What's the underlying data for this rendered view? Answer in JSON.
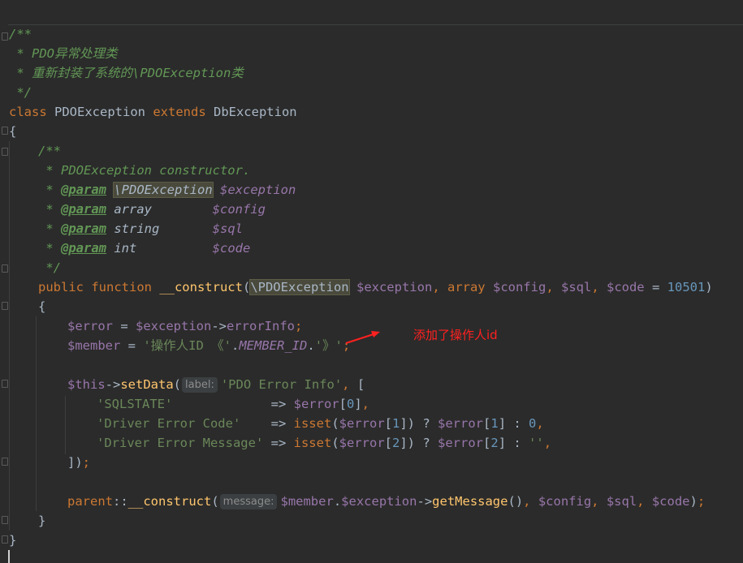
{
  "editor": {
    "lines": [
      {
        "id": "top",
        "segs": [
          {
            "c": "var",
            "t": "  "
          }
        ]
      },
      {
        "id": "doc-open",
        "segs": [
          {
            "c": "cm",
            "t": "/**"
          }
        ]
      },
      {
        "id": "doc-1",
        "segs": [
          {
            "c": "cm",
            "t": " * PDO异常处理类"
          }
        ]
      },
      {
        "id": "doc-2",
        "segs": [
          {
            "c": "cm",
            "t": " * 重新封装了系统的\\PDOException类"
          }
        ]
      },
      {
        "id": "doc-close",
        "segs": [
          {
            "c": "cm",
            "t": " */"
          }
        ]
      },
      {
        "id": "class-decl",
        "segs": [
          {
            "c": "kw",
            "t": "class "
          },
          {
            "c": "",
            "t": "PDOException "
          },
          {
            "c": "kw",
            "t": "extends "
          },
          {
            "c": "",
            "t": "DbException"
          }
        ]
      },
      {
        "id": "brace-open",
        "segs": [
          {
            "c": "",
            "t": "{"
          }
        ]
      },
      {
        "id": "mdoc-open",
        "indent": 1,
        "segs": [
          {
            "c": "cm",
            "t": "/**"
          }
        ]
      },
      {
        "id": "mdoc-1",
        "indent": 1,
        "segs": [
          {
            "c": "cm",
            "t": " * PDOException constructor."
          }
        ]
      },
      {
        "id": "mdoc-p1",
        "indent": 1,
        "segs": [
          {
            "c": "cm",
            "t": " * "
          },
          {
            "c": "tag",
            "t": "@param"
          },
          {
            "c": "cm",
            "t": " "
          },
          {
            "c": "cmtype hl",
            "t": "\\PDOException"
          },
          {
            "c": "cm",
            "t": " "
          },
          {
            "c": "docv",
            "t": "$exception"
          }
        ]
      },
      {
        "id": "mdoc-p2",
        "indent": 1,
        "segs": [
          {
            "c": "cm",
            "t": " * "
          },
          {
            "c": "tag",
            "t": "@param"
          },
          {
            "c": "cm",
            "t": " "
          },
          {
            "c": "cmtype",
            "t": "array        "
          },
          {
            "c": "docv",
            "t": "$config"
          }
        ]
      },
      {
        "id": "mdoc-p3",
        "indent": 1,
        "segs": [
          {
            "c": "cm",
            "t": " * "
          },
          {
            "c": "tag",
            "t": "@param"
          },
          {
            "c": "cm",
            "t": " "
          },
          {
            "c": "cmtype",
            "t": "string       "
          },
          {
            "c": "docv",
            "t": "$sql"
          }
        ]
      },
      {
        "id": "mdoc-p4",
        "indent": 1,
        "segs": [
          {
            "c": "cm",
            "t": " * "
          },
          {
            "c": "tag",
            "t": "@param"
          },
          {
            "c": "cm",
            "t": " "
          },
          {
            "c": "cmtype",
            "t": "int          "
          },
          {
            "c": "docv",
            "t": "$code"
          }
        ]
      },
      {
        "id": "mdoc-close",
        "indent": 1,
        "segs": [
          {
            "c": "cm",
            "t": " */"
          }
        ]
      },
      {
        "id": "fn-decl",
        "indent": 1,
        "segs": [
          {
            "c": "kw",
            "t": "public function "
          },
          {
            "c": "fn",
            "t": "__construct"
          },
          {
            "c": "",
            "t": "("
          },
          {
            "c": "hl",
            "t": "\\PDOException"
          },
          {
            "c": "",
            "t": " "
          },
          {
            "c": "var",
            "t": "$exception"
          },
          {
            "c": "kw",
            "t": ", "
          },
          {
            "c": "kw",
            "t": "array "
          },
          {
            "c": "var",
            "t": "$config"
          },
          {
            "c": "kw",
            "t": ", "
          },
          {
            "c": "var",
            "t": "$sql"
          },
          {
            "c": "kw",
            "t": ", "
          },
          {
            "c": "var",
            "t": "$code"
          },
          {
            "c": "",
            "t": " = "
          },
          {
            "c": "num",
            "t": "10501"
          },
          {
            "c": "",
            "t": ")"
          }
        ]
      },
      {
        "id": "fn-brace",
        "indent": 1,
        "segs": [
          {
            "c": "",
            "t": "{"
          }
        ]
      },
      {
        "id": "stmt-error",
        "indent": 2,
        "segs": [
          {
            "c": "var",
            "t": "$error"
          },
          {
            "c": "",
            "t": " = "
          },
          {
            "c": "var",
            "t": "$exception"
          },
          {
            "c": "",
            "t": "->"
          },
          {
            "c": "var",
            "t": "errorInfo"
          },
          {
            "c": "kw",
            "t": ";"
          }
        ]
      },
      {
        "id": "stmt-member",
        "indent": 2,
        "segs": [
          {
            "c": "var",
            "t": "$member"
          },
          {
            "c": "",
            "t": " = "
          },
          {
            "c": "str",
            "t": "'操作人ID 《'"
          },
          {
            "c": "",
            "t": "."
          },
          {
            "c": "ph",
            "t": "MEMBER_ID"
          },
          {
            "c": "",
            "t": "."
          },
          {
            "c": "str",
            "t": "'》'"
          },
          {
            "c": "kw",
            "t": ";"
          }
        ]
      },
      {
        "id": "blank-1",
        "segs": []
      },
      {
        "id": "stmt-setdata",
        "indent": 2,
        "segs": [
          {
            "c": "var",
            "t": "$this"
          },
          {
            "c": "",
            "t": "->"
          },
          {
            "c": "fn",
            "t": "setData"
          },
          {
            "c": "",
            "t": "("
          },
          {
            "c": "hint",
            "t": "label:"
          },
          {
            "c": "str",
            "t": "'PDO Error Info'"
          },
          {
            "c": "kw",
            "t": ", "
          },
          {
            "c": "",
            "t": "["
          }
        ]
      },
      {
        "id": "arr-1",
        "indent": 3,
        "segs": [
          {
            "c": "str",
            "t": "'SQLSTATE'"
          },
          {
            "c": "",
            "t": "             => "
          },
          {
            "c": "var",
            "t": "$error"
          },
          {
            "c": "",
            "t": "["
          },
          {
            "c": "num",
            "t": "0"
          },
          {
            "c": "",
            "t": "]"
          },
          {
            "c": "kw",
            "t": ","
          }
        ]
      },
      {
        "id": "arr-2",
        "indent": 3,
        "segs": [
          {
            "c": "str",
            "t": "'Driver Error Code'"
          },
          {
            "c": "",
            "t": "    => "
          },
          {
            "c": "kw",
            "t": "isset"
          },
          {
            "c": "",
            "t": "("
          },
          {
            "c": "var",
            "t": "$error"
          },
          {
            "c": "",
            "t": "["
          },
          {
            "c": "num",
            "t": "1"
          },
          {
            "c": "",
            "t": "]) ? "
          },
          {
            "c": "var",
            "t": "$error"
          },
          {
            "c": "",
            "t": "["
          },
          {
            "c": "num",
            "t": "1"
          },
          {
            "c": "",
            "t": "] : "
          },
          {
            "c": "num",
            "t": "0"
          },
          {
            "c": "kw",
            "t": ","
          }
        ]
      },
      {
        "id": "arr-3",
        "indent": 3,
        "segs": [
          {
            "c": "str",
            "t": "'Driver Error Message'"
          },
          {
            "c": "",
            "t": " => "
          },
          {
            "c": "kw",
            "t": "isset"
          },
          {
            "c": "",
            "t": "("
          },
          {
            "c": "var",
            "t": "$error"
          },
          {
            "c": "",
            "t": "["
          },
          {
            "c": "num",
            "t": "2"
          },
          {
            "c": "",
            "t": "]) ? "
          },
          {
            "c": "var",
            "t": "$error"
          },
          {
            "c": "",
            "t": "["
          },
          {
            "c": "num",
            "t": "2"
          },
          {
            "c": "",
            "t": "] : "
          },
          {
            "c": "str",
            "t": "''"
          },
          {
            "c": "kw",
            "t": ","
          }
        ]
      },
      {
        "id": "arr-close",
        "indent": 2,
        "segs": [
          {
            "c": "",
            "t": "])"
          },
          {
            "c": "kw",
            "t": ";"
          }
        ]
      },
      {
        "id": "blank-2",
        "segs": []
      },
      {
        "id": "stmt-parent",
        "indent": 2,
        "segs": [
          {
            "c": "kw",
            "t": "parent"
          },
          {
            "c": "",
            "t": "::"
          },
          {
            "c": "fn",
            "t": "__construct"
          },
          {
            "c": "",
            "t": "("
          },
          {
            "c": "hint",
            "t": "message:"
          },
          {
            "c": "var",
            "t": "$member"
          },
          {
            "c": "",
            "t": "."
          },
          {
            "c": "var",
            "t": "$exception"
          },
          {
            "c": "",
            "t": "->"
          },
          {
            "c": "fn",
            "t": "getMessage"
          },
          {
            "c": "",
            "t": "()"
          },
          {
            "c": "kw",
            "t": ", "
          },
          {
            "c": "var",
            "t": "$config"
          },
          {
            "c": "kw",
            "t": ", "
          },
          {
            "c": "var",
            "t": "$sql"
          },
          {
            "c": "kw",
            "t": ", "
          },
          {
            "c": "var",
            "t": "$code"
          },
          {
            "c": "",
            "t": ")"
          },
          {
            "c": "kw",
            "t": ";"
          }
        ]
      },
      {
        "id": "fn-close",
        "indent": 1,
        "segs": [
          {
            "c": "",
            "t": "}"
          }
        ]
      },
      {
        "id": "class-close",
        "segs": [
          {
            "c": "",
            "t": "}"
          }
        ]
      }
    ]
  },
  "annotation": {
    "text": "添加了操作人id",
    "color": "#ff2020"
  }
}
